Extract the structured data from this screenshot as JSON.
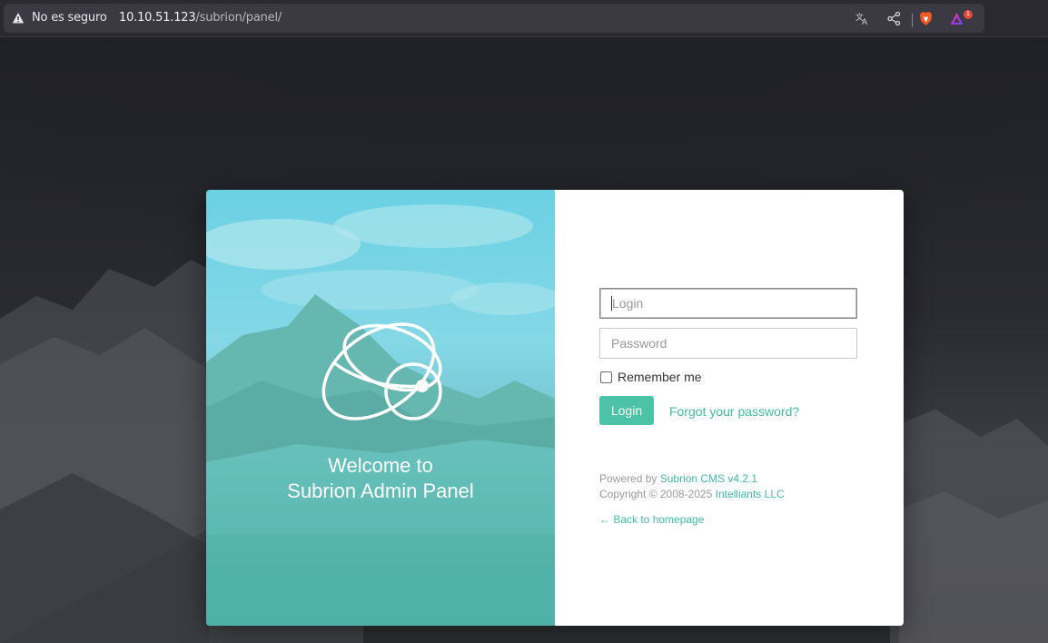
{
  "browser": {
    "security_label": "No es seguro",
    "url_host": "10.10.51.123",
    "url_path": "/subrion/panel/",
    "notification_count": "1"
  },
  "hero": {
    "welcome_line1": "Welcome to",
    "welcome_line2": "Subrion Admin Panel"
  },
  "form": {
    "login_placeholder": "Login",
    "password_placeholder": "Password",
    "remember_label": "Remember me",
    "remember_checked": false,
    "login_button": "Login",
    "forgot_link": "Forgot your password?"
  },
  "footer": {
    "powered_prefix": "Powered by",
    "powered_link": "Subrion CMS v4.2.1",
    "copyright_prefix": "Copyright © 2008-2025",
    "copyright_link": "Intelliants LLC",
    "back_link": "← Back to homepage"
  },
  "colors": {
    "accent": "#4cc3a6",
    "link": "#40bfa1",
    "chrome_bg": "#2b2930",
    "hero_tint": "#5bc7d6"
  },
  "icons": {
    "security": "warning-triangle-icon",
    "translate": "translate-icon",
    "share": "share-icon",
    "brave": "brave-shield-icon",
    "rewards": "brave-rewards-icon",
    "logo": "subrion-logo-icon"
  }
}
